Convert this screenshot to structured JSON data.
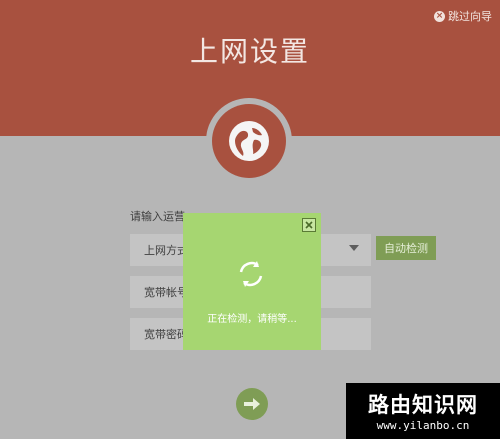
{
  "header": {
    "skip_label": "跳过向导",
    "title": "上网设置"
  },
  "form": {
    "intro": "请输入运营",
    "connection_type_label": "上网方式",
    "auto_detect_label": "自动检测",
    "account_label": "宽带帐号",
    "password_label": "宽带密码"
  },
  "modal": {
    "status_text": "正在检测，请稍等..."
  },
  "watermark": {
    "title": "路由知识网",
    "url": "www.yilanbo.cn"
  },
  "colors": {
    "header_bg": "#a8513f",
    "page_bg": "#b6b6b6",
    "accent_green": "#7f9d55",
    "modal_bg": "#a6d671"
  },
  "icons": {
    "globe": "globe-icon",
    "refresh": "refresh-icon",
    "next": "arrow-right-icon",
    "close": "close-icon"
  }
}
